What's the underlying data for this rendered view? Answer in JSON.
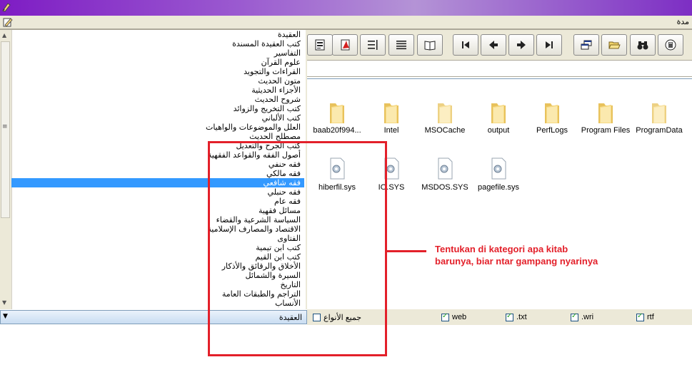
{
  "window": {
    "title_fragment": "مدة"
  },
  "categories": {
    "items": [
      "العقيدة",
      "كتب العقيدة المسندة",
      "التفاسير",
      "علوم القرآن",
      "القراءات والتجويد",
      "متون الحديث",
      "الأجزاء الحديثية",
      "شروح الحديث",
      "كتب التخريج والزوائد",
      "كتب الألباني",
      "العلل والموضوعات والواهيات",
      "مصطلح الحديث",
      "كتب الجرح والتعديل",
      "أصول الفقه والقواعد الفقهية",
      "فقه حنفي",
      "فقه مالكي",
      "فقه شافعي",
      "فقه حنبلي",
      "فقه عام",
      "مسائل فقهية",
      "السياسة الشرعية والقضاء",
      "الاقتصاد والمصارف الإسلامية",
      "الفتاوى",
      "كتب ابن تيمية",
      "كتب ابن القيم",
      "الأخلاق والرقائق والأذكار",
      "السيرة والشمائل",
      "التاريخ",
      "التراجم والطبقات العامة",
      "الأنساب"
    ],
    "selected_index": 16,
    "combo_value": "العقيدة"
  },
  "toolbar": {
    "buttons": [
      {
        "name": "properties-button",
        "icon": "properties-icon"
      },
      {
        "name": "pdf-button",
        "icon": "pdf-icon"
      },
      {
        "name": "numbered-list-button",
        "icon": "numbered-list-icon"
      },
      {
        "name": "list-button",
        "icon": "list-icon"
      },
      {
        "name": "open-book-button",
        "icon": "book-icon"
      },
      {
        "name": "first-button",
        "icon": "first-icon"
      },
      {
        "name": "previous-button",
        "icon": "previous-icon"
      },
      {
        "name": "next-button",
        "icon": "next-icon"
      },
      {
        "name": "last-button",
        "icon": "last-icon"
      },
      {
        "name": "windows-button",
        "icon": "windows-icon"
      },
      {
        "name": "open-folder-button",
        "icon": "folder-open-icon"
      },
      {
        "name": "find-button",
        "icon": "binoculars-icon"
      },
      {
        "name": "index-button",
        "icon": "index-book-icon"
      }
    ]
  },
  "files": {
    "folders": [
      "baab20f994...",
      "Intel",
      "MSOCache",
      "output",
      "PerfLogs",
      "Program Files",
      "ProgramData"
    ],
    "system_files": [
      "hiberfil.sys",
      "IO.SYS",
      "MSDOS.SYS",
      "pagefile.sys"
    ]
  },
  "filters": {
    "all_types_label": "جميع الأنواع",
    "all_types_checked": false,
    "types": [
      {
        "label": "web",
        "checked": true
      },
      {
        "label": ".txt",
        "checked": true
      },
      {
        "label": ".wri",
        "checked": true
      },
      {
        "label": "rtf",
        "checked": true
      }
    ]
  },
  "annotation": {
    "text": "Tentukan di kategori apa kitab barunya, biar ntar gampang nyarinya",
    "color": "#e3202a"
  },
  "colors": {
    "selection": "#3399ff",
    "title_bar": "#7e1cc4",
    "chrome": "#ece9d8"
  }
}
